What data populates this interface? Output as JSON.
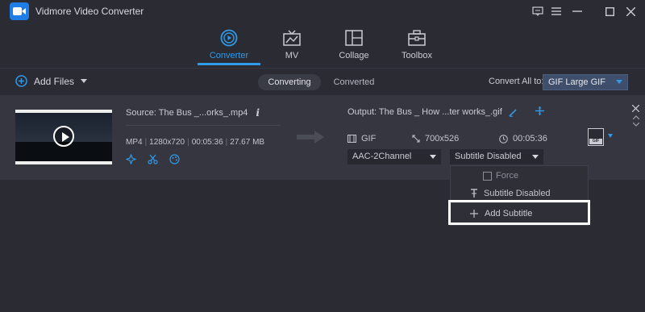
{
  "app": {
    "title": "Vidmore Video Converter"
  },
  "nav": {
    "items": [
      {
        "label": "Converter",
        "icon": "converter-icon",
        "active": true
      },
      {
        "label": "MV",
        "icon": "mv-icon",
        "active": false
      },
      {
        "label": "Collage",
        "icon": "collage-icon",
        "active": false
      },
      {
        "label": "Toolbox",
        "icon": "toolbox-icon",
        "active": false
      }
    ]
  },
  "toolbar": {
    "add_files": "Add Files",
    "tabs": {
      "converting": "Converting",
      "converted": "Converted"
    },
    "convert_all_label": "Convert All to:",
    "convert_all_value": "GIF Large GIF"
  },
  "file": {
    "source": "Source: The Bus _...orks_.mp4",
    "format": "MP4",
    "resolution": "1280x720",
    "duration": "00:05:36",
    "size": "27.67 MB",
    "output": "Output: The Bus _ How ...ter works_.gif",
    "out_format": "GIF",
    "out_resolution": "700x526",
    "out_duration": "00:05:36",
    "audio_track": "AAC-2Channel",
    "subtitle": "Subtitle Disabled",
    "badge": "GIF"
  },
  "dropdown": {
    "force": "Force",
    "disabled": "Subtitle Disabled",
    "add": "Add Subtitle"
  },
  "colors": {
    "accent": "#2f9ae8",
    "background": "#2b2c33",
    "row": "#353640"
  }
}
